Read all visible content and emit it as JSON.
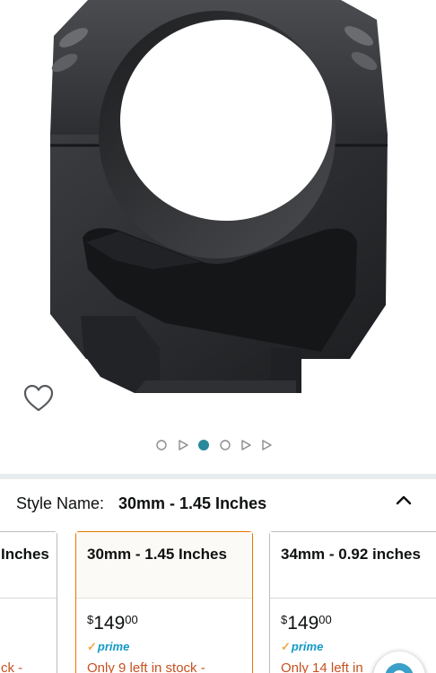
{
  "product": {
    "image_alt": "Scope ring mount product image",
    "wishlist_icon": "heart-outline-icon"
  },
  "carousel": {
    "dots": [
      "circle",
      "play",
      "circle",
      "circle",
      "play",
      "play"
    ],
    "active_index": 2,
    "colors": {
      "active": "#2a8a9c",
      "inactive": "#8c8c8c"
    }
  },
  "style_selector": {
    "label": "Style Name:",
    "value": "30mm - 1.45 Inches",
    "collapse_icon": "chevron-up-icon"
  },
  "options": [
    {
      "title": "Inches",
      "stock": "ck -",
      "selected": false
    },
    {
      "title": "30mm - 1.45 Inches",
      "price_symbol": "$",
      "price_whole": "149",
      "price_fraction": "00",
      "prime": "prime",
      "stock": "Only 9 left in stock -",
      "selected": true
    },
    {
      "title": "34mm - 0.92 inches",
      "price_symbol": "$",
      "price_whole": "149",
      "price_fraction": "00",
      "prime": "prime",
      "stock": "Only 14 left in",
      "selected": false
    }
  ],
  "floating_button": {
    "icon": "search-lens-icon"
  },
  "colors": {
    "selected_border": "#e77600",
    "stock_text": "#c7511f",
    "prime": "#1399c6"
  }
}
